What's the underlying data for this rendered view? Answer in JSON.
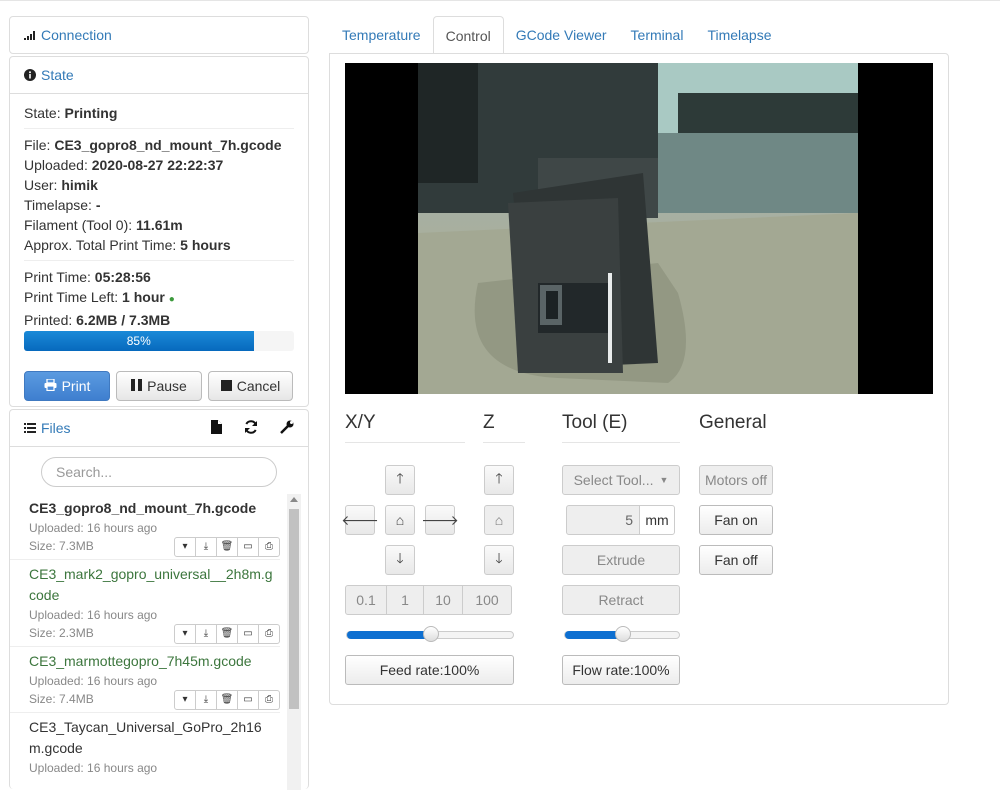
{
  "sidebar": {
    "connection": {
      "title": "Connection"
    },
    "state": {
      "title": "State",
      "state_label": "State:",
      "state_value": "Printing",
      "file_label": "File:",
      "file_value": "CE3_gopro8_nd_mount_7h.gcode",
      "uploaded_label": "Uploaded:",
      "uploaded_value": "2020-08-27 22:22:37",
      "user_label": "User:",
      "user_value": "himik",
      "timelapse_label": "Timelapse:",
      "timelapse_value": "-",
      "filament_label": "Filament (Tool 0):",
      "filament_value": "11.61m",
      "approx_label": "Approx. Total Print Time:",
      "approx_value": "5 hours",
      "print_time_label": "Print Time:",
      "print_time_value": "05:28:56",
      "time_left_label": "Print Time Left:",
      "time_left_value": "1 hour",
      "printed_label": "Printed:",
      "printed_value": "6.2MB / 7.3MB",
      "progress": 0.85,
      "progress_label": "85%",
      "print_button": "Print",
      "pause_button": "Pause",
      "cancel_button": "Cancel"
    },
    "files": {
      "title": "Files",
      "search_placeholder": "Search...",
      "items": [
        {
          "name": "CE3_gopro8_nd_mount_7h.gcode",
          "uploaded": "Uploaded: 16 hours ago",
          "size": "Size: 7.3MB"
        },
        {
          "name": "CE3_mark2_gopro_universal__2h8m.gcode",
          "uploaded": "Uploaded: 16 hours ago",
          "size": "Size: 2.3MB"
        },
        {
          "name": "CE3_marmottegopro_7h45m.gcode",
          "uploaded": "Uploaded: 16 hours ago",
          "size": "Size: 7.4MB"
        },
        {
          "name": "CE3_Taycan_Universal_GoPro_2h16m.gcode",
          "uploaded": "Uploaded: 16 hours ago",
          "size": ""
        }
      ]
    }
  },
  "tabs": [
    "Temperature",
    "Control",
    "GCode Viewer",
    "Terminal",
    "Timelapse"
  ],
  "control": {
    "xy_title": "X/Y",
    "z_title": "Z",
    "tool_title": "Tool (E)",
    "general_title": "General",
    "steps": [
      "0.1",
      "1",
      "10",
      "100"
    ],
    "feed_rate": "Feed rate:100%",
    "feed_rate_value": 0.5,
    "select_tool": "Select Tool...",
    "extrude_amount": "5",
    "extrude_unit": "mm",
    "extrude": "Extrude",
    "retract": "Retract",
    "flow_rate": "Flow rate:100%",
    "flow_rate_value": 0.5,
    "motors_off": "Motors off",
    "fan_on": "Fan on",
    "fan_off": "Fan off"
  }
}
